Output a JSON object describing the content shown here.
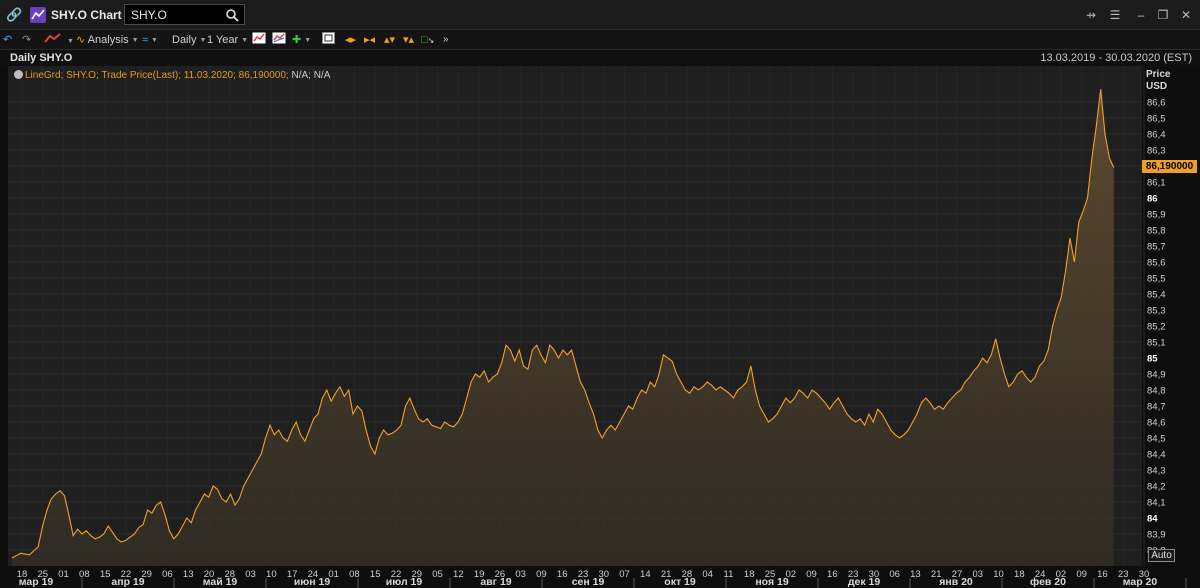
{
  "window": {
    "title": "SHY.O Chart",
    "search_value": "SHY.O"
  },
  "toolbar": {
    "analysis_label": "Analysis",
    "interval_label": "Daily",
    "range_label": "1 Year"
  },
  "chart_header": {
    "name": "Daily SHY.O",
    "date_range": "13.03.2019 - 30.03.2020 (EST)"
  },
  "legend": {
    "text": "LineGrd; SHY.O; Trade Price(Last); 11.03.2020; 86,190000;",
    "rest": "N/A; N/A"
  },
  "axis": {
    "price_label": "Price",
    "currency_label": "USD",
    "last_price": "86,190000",
    "auto_label": "Auto"
  },
  "chart_data": {
    "type": "area",
    "series": [
      {
        "name": "SHY.O; Trade Price(Last)",
        "color": "#f0a030",
        "values": [
          [
            0,
            83.75
          ],
          [
            2,
            83.78
          ],
          [
            4,
            83.77
          ],
          [
            6,
            83.82
          ],
          [
            7,
            83.95
          ],
          [
            8,
            84.05
          ],
          [
            9,
            84.12
          ],
          [
            10,
            84.15
          ],
          [
            11,
            84.17
          ],
          [
            12,
            84.14
          ],
          [
            13,
            84.02
          ],
          [
            14,
            83.89
          ],
          [
            15,
            83.93
          ],
          [
            16,
            83.9
          ],
          [
            17,
            83.92
          ],
          [
            18,
            83.89
          ],
          [
            19,
            83.87
          ],
          [
            20,
            83.88
          ],
          [
            21,
            83.9
          ],
          [
            22,
            83.95
          ],
          [
            23,
            83.91
          ],
          [
            24,
            83.87
          ],
          [
            25,
            83.85
          ],
          [
            26,
            83.86
          ],
          [
            27,
            83.88
          ],
          [
            28,
            83.9
          ],
          [
            29,
            83.94
          ],
          [
            30,
            83.96
          ],
          [
            31,
            84.05
          ],
          [
            32,
            84.03
          ],
          [
            33,
            84.08
          ],
          [
            34,
            84.1
          ],
          [
            35,
            84.02
          ],
          [
            36,
            83.92
          ],
          [
            37,
            83.87
          ],
          [
            38,
            83.9
          ],
          [
            39,
            83.95
          ],
          [
            40,
            84.0
          ],
          [
            41,
            83.97
          ],
          [
            42,
            84.05
          ],
          [
            43,
            84.1
          ],
          [
            44,
            84.15
          ],
          [
            45,
            84.13
          ],
          [
            46,
            84.2
          ],
          [
            47,
            84.18
          ],
          [
            48,
            84.12
          ],
          [
            49,
            84.1
          ],
          [
            50,
            84.15
          ],
          [
            51,
            84.08
          ],
          [
            52,
            84.12
          ],
          [
            53,
            84.2
          ],
          [
            54,
            84.25
          ],
          [
            55,
            84.3
          ],
          [
            56,
            84.35
          ],
          [
            57,
            84.4
          ],
          [
            58,
            84.5
          ],
          [
            59,
            84.58
          ],
          [
            60,
            84.52
          ],
          [
            61,
            84.55
          ],
          [
            62,
            84.5
          ],
          [
            63,
            84.48
          ],
          [
            64,
            84.55
          ],
          [
            65,
            84.6
          ],
          [
            66,
            84.52
          ],
          [
            67,
            84.48
          ],
          [
            68,
            84.55
          ],
          [
            69,
            84.62
          ],
          [
            70,
            84.65
          ],
          [
            71,
            84.75
          ],
          [
            72,
            84.8
          ],
          [
            73,
            84.73
          ],
          [
            74,
            84.78
          ],
          [
            75,
            84.82
          ],
          [
            76,
            84.76
          ],
          [
            77,
            84.8
          ],
          [
            78,
            84.65
          ],
          [
            79,
            84.7
          ],
          [
            80,
            84.67
          ],
          [
            81,
            84.55
          ],
          [
            82,
            84.45
          ],
          [
            83,
            84.4
          ],
          [
            84,
            84.5
          ],
          [
            85,
            84.55
          ],
          [
            86,
            84.52
          ],
          [
            87,
            84.53
          ],
          [
            88,
            84.55
          ],
          [
            89,
            84.58
          ],
          [
            90,
            84.7
          ],
          [
            91,
            84.75
          ],
          [
            92,
            84.68
          ],
          [
            93,
            84.62
          ],
          [
            94,
            84.6
          ],
          [
            95,
            84.62
          ],
          [
            96,
            84.58
          ],
          [
            97,
            84.57
          ],
          [
            98,
            84.56
          ],
          [
            99,
            84.6
          ],
          [
            100,
            84.58
          ],
          [
            101,
            84.57
          ],
          [
            102,
            84.6
          ],
          [
            103,
            84.65
          ],
          [
            104,
            84.75
          ],
          [
            105,
            84.85
          ],
          [
            106,
            84.9
          ],
          [
            107,
            84.88
          ],
          [
            108,
            84.92
          ],
          [
            109,
            84.85
          ],
          [
            110,
            84.88
          ],
          [
            111,
            84.9
          ],
          [
            112,
            84.97
          ],
          [
            113,
            85.08
          ],
          [
            114,
            85.05
          ],
          [
            115,
            84.98
          ],
          [
            116,
            85.05
          ],
          [
            117,
            84.95
          ],
          [
            118,
            84.93
          ],
          [
            119,
            85.05
          ],
          [
            120,
            85.08
          ],
          [
            121,
            85.02
          ],
          [
            122,
            84.97
          ],
          [
            123,
            85.08
          ],
          [
            124,
            85.05
          ],
          [
            125,
            85.0
          ],
          [
            126,
            85.05
          ],
          [
            127,
            85.02
          ],
          [
            128,
            85.05
          ],
          [
            129,
            84.95
          ],
          [
            130,
            84.85
          ],
          [
            131,
            84.8
          ],
          [
            132,
            84.72
          ],
          [
            133,
            84.65
          ],
          [
            134,
            84.55
          ],
          [
            135,
            84.5
          ],
          [
            136,
            84.55
          ],
          [
            137,
            84.58
          ],
          [
            138,
            84.55
          ],
          [
            139,
            84.6
          ],
          [
            140,
            84.65
          ],
          [
            141,
            84.7
          ],
          [
            142,
            84.68
          ],
          [
            143,
            84.75
          ],
          [
            144,
            84.8
          ],
          [
            145,
            84.78
          ],
          [
            146,
            84.85
          ],
          [
            147,
            84.82
          ],
          [
            148,
            84.9
          ],
          [
            149,
            85.02
          ],
          [
            150,
            85.0
          ],
          [
            151,
            84.98
          ],
          [
            152,
            84.9
          ],
          [
            153,
            84.85
          ],
          [
            154,
            84.8
          ],
          [
            155,
            84.78
          ],
          [
            156,
            84.82
          ],
          [
            157,
            84.8
          ],
          [
            158,
            84.82
          ],
          [
            159,
            84.85
          ],
          [
            160,
            84.83
          ],
          [
            161,
            84.8
          ],
          [
            162,
            84.82
          ],
          [
            163,
            84.8
          ],
          [
            164,
            84.78
          ],
          [
            165,
            84.75
          ],
          [
            166,
            84.8
          ],
          [
            167,
            84.82
          ],
          [
            168,
            84.85
          ],
          [
            169,
            84.95
          ],
          [
            170,
            84.8
          ],
          [
            171,
            84.7
          ],
          [
            172,
            84.65
          ],
          [
            173,
            84.6
          ],
          [
            174,
            84.62
          ],
          [
            175,
            84.65
          ],
          [
            176,
            84.7
          ],
          [
            177,
            84.75
          ],
          [
            178,
            84.72
          ],
          [
            179,
            84.75
          ],
          [
            180,
            84.8
          ],
          [
            181,
            84.78
          ],
          [
            182,
            84.75
          ],
          [
            183,
            84.8
          ],
          [
            184,
            84.78
          ],
          [
            185,
            84.75
          ],
          [
            186,
            84.72
          ],
          [
            187,
            84.68
          ],
          [
            188,
            84.72
          ],
          [
            189,
            84.75
          ],
          [
            190,
            84.7
          ],
          [
            191,
            84.65
          ],
          [
            192,
            84.62
          ],
          [
            193,
            84.6
          ],
          [
            194,
            84.62
          ],
          [
            195,
            84.58
          ],
          [
            196,
            84.65
          ],
          [
            197,
            84.6
          ],
          [
            198,
            84.68
          ],
          [
            199,
            84.65
          ],
          [
            200,
            84.6
          ],
          [
            201,
            84.55
          ],
          [
            202,
            84.52
          ],
          [
            203,
            84.5
          ],
          [
            204,
            84.52
          ],
          [
            205,
            84.55
          ],
          [
            206,
            84.6
          ],
          [
            207,
            84.65
          ],
          [
            208,
            84.72
          ],
          [
            209,
            84.75
          ],
          [
            210,
            84.72
          ],
          [
            211,
            84.68
          ],
          [
            212,
            84.7
          ],
          [
            213,
            84.68
          ],
          [
            214,
            84.72
          ],
          [
            215,
            84.75
          ],
          [
            216,
            84.78
          ],
          [
            217,
            84.8
          ],
          [
            218,
            84.85
          ],
          [
            219,
            84.88
          ],
          [
            220,
            84.92
          ],
          [
            221,
            84.95
          ],
          [
            222,
            85.0
          ],
          [
            223,
            84.97
          ],
          [
            224,
            85.02
          ],
          [
            225,
            85.12
          ],
          [
            226,
            85.0
          ],
          [
            227,
            84.9
          ],
          [
            228,
            84.82
          ],
          [
            229,
            84.85
          ],
          [
            230,
            84.9
          ],
          [
            231,
            84.92
          ],
          [
            232,
            84.88
          ],
          [
            233,
            84.85
          ],
          [
            234,
            84.88
          ],
          [
            235,
            84.95
          ],
          [
            236,
            84.98
          ],
          [
            237,
            85.05
          ],
          [
            238,
            85.2
          ],
          [
            239,
            85.3
          ],
          [
            240,
            85.38
          ],
          [
            241,
            85.55
          ],
          [
            242,
            85.75
          ],
          [
            243,
            85.6
          ],
          [
            244,
            85.85
          ],
          [
            245,
            85.92
          ],
          [
            246,
            86.0
          ],
          [
            247,
            86.25
          ],
          [
            248,
            86.45
          ],
          [
            249,
            86.68
          ],
          [
            250,
            86.4
          ],
          [
            251,
            86.25
          ],
          [
            252,
            86.19
          ]
        ]
      }
    ],
    "ylim": [
      83.7,
      86.7
    ],
    "y_ticks": [
      "83,8",
      "83,9",
      "84",
      "84,1",
      "84,2",
      "84,3",
      "84,4",
      "84,5",
      "84,6",
      "84,7",
      "84,8",
      "84,9",
      "85",
      "85,1",
      "85,2",
      "85,3",
      "85,4",
      "85,5",
      "85,6",
      "85,7",
      "85,8",
      "85,9",
      "86",
      "86,1",
      "86,2",
      "86,3",
      "86,4",
      "86,5",
      "86,6"
    ],
    "x_ticks": [
      "18",
      "25",
      "01",
      "08",
      "15",
      "22",
      "29",
      "06",
      "13",
      "20",
      "28",
      "03",
      "10",
      "17",
      "24",
      "01",
      "08",
      "15",
      "22",
      "29",
      "05",
      "12",
      "19",
      "26",
      "03",
      "09",
      "16",
      "23",
      "30",
      "07",
      "14",
      "21",
      "28",
      "04",
      "11",
      "18",
      "25",
      "02",
      "09",
      "16",
      "23",
      "30",
      "06",
      "13",
      "21",
      "27",
      "03",
      "10",
      "18",
      "24",
      "02",
      "09",
      "16",
      "23",
      "30"
    ],
    "months": [
      "мар 19",
      "апр 19",
      "май 19",
      "июн 19",
      "июл 19",
      "авг 19",
      "сен 19",
      "окт 19",
      "ноя 19",
      "дек 19",
      "янв 20",
      "фев 20",
      "мар 20"
    ],
    "grid": true,
    "legend": "top-left"
  }
}
